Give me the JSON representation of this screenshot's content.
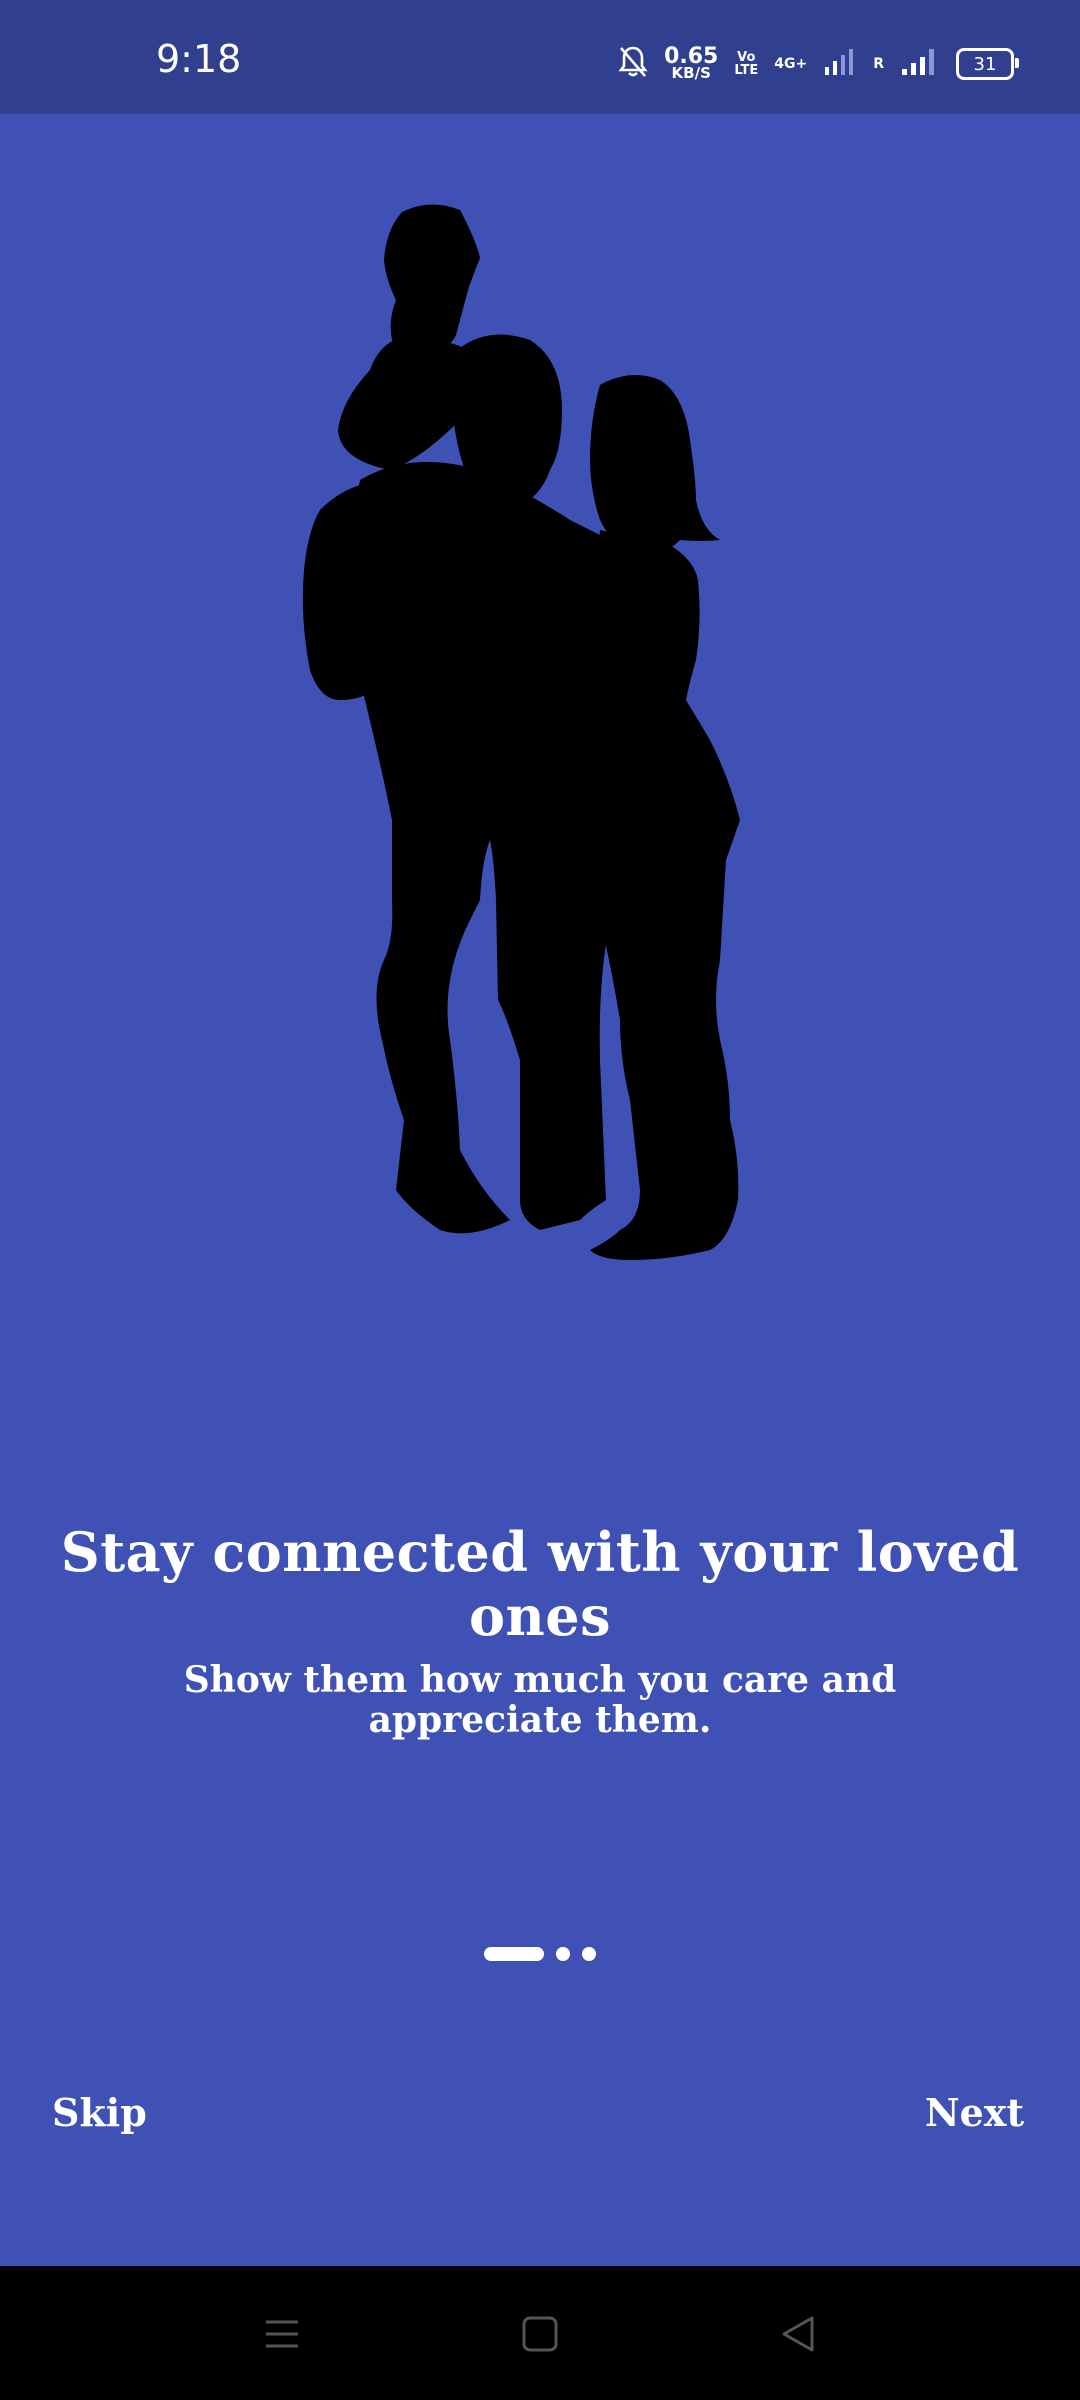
{
  "status_bar": {
    "time": "9:18",
    "net_speed_value": "0.65",
    "net_speed_unit": "KB/S",
    "volte_top": "Vo",
    "volte_bottom": "LTE",
    "network_type": "4G+",
    "roaming": "R",
    "battery": "31",
    "icons": [
      "mute-bell-icon",
      "signal-icon",
      "battery-icon"
    ]
  },
  "onboarding": {
    "headline": "Stay connected with your loved ones",
    "subtitle": "Show them how much you care and appreciate them.",
    "page_count": 3,
    "active_page": 1,
    "skip_label": "Skip",
    "next_label": "Next"
  },
  "nav_bar": {
    "icons": [
      "menu-icon",
      "home-icon",
      "back-icon"
    ]
  },
  "colors": {
    "background": "#3f51b5",
    "status_bar": "#303f8e",
    "text": "#ffffff",
    "silhouette": "#000000"
  }
}
